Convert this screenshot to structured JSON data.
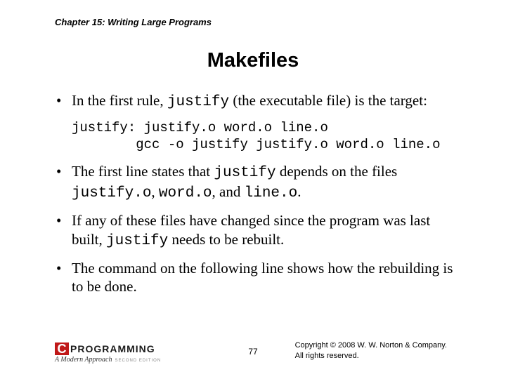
{
  "chapter_header": "Chapter 15: Writing Large Programs",
  "title": "Makefiles",
  "bullets": {
    "b1": {
      "pre": "In the first rule, ",
      "code": "justify",
      "post": " (the executable file) is the target:"
    },
    "code_block": "justify: justify.o word.o line.o\n        gcc -o justify justify.o word.o line.o",
    "b2": {
      "t1": "The first line states that ",
      "c1": "justify",
      "t2": " depends on the files ",
      "c2": "justify.o",
      "t3": ", ",
      "c3": "word.o",
      "t4": ", and ",
      "c4": "line.o",
      "t5": "."
    },
    "b3": {
      "t1": "If any of these files have changed since the program was last built, ",
      "c1": "justify",
      "t2": " needs to be rebuilt."
    },
    "b4": "The command on the following line shows how the rebuilding is to be done."
  },
  "footer": {
    "logo_c": "C",
    "logo_text": "PROGRAMMING",
    "logo_sub": "A Modern Approach",
    "logo_edition": "SECOND EDITION",
    "page": "77",
    "copyright_l1": "Copyright © 2008 W. W. Norton & Company.",
    "copyright_l2": "All rights reserved."
  }
}
